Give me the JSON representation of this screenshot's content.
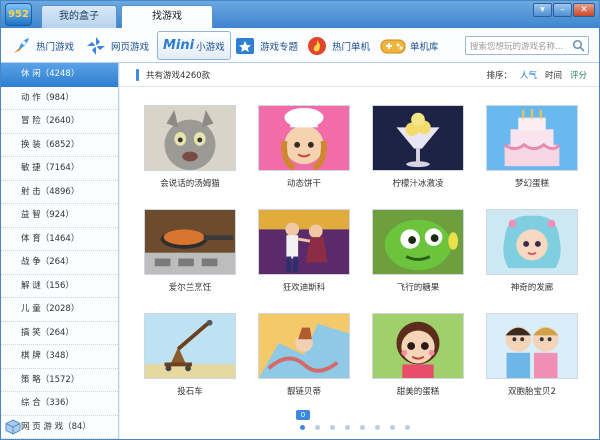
{
  "titlebar": {
    "logo_text": "952",
    "tabs": [
      {
        "label": "我的盒子"
      },
      {
        "label": "找游戏"
      }
    ]
  },
  "toolbar": {
    "items": [
      {
        "label": "热门游戏",
        "icon": "rocket-icon"
      },
      {
        "label": "网页游戏",
        "icon": "windmill-icon"
      },
      {
        "badge": "Mini",
        "label": "小游戏",
        "icon": "mini-icon"
      },
      {
        "label": "游戏专题",
        "icon": "star-icon"
      },
      {
        "label": "热门单机",
        "icon": "fire-icon"
      },
      {
        "label": "单机库",
        "icon": "gamepad-icon"
      }
    ],
    "search_placeholder": "搜索您想玩的游戏名称..."
  },
  "sidebar": {
    "items": [
      {
        "label": "休 闲（4248）"
      },
      {
        "label": "动 作（984）"
      },
      {
        "label": "冒 险（2640）"
      },
      {
        "label": "换 装（6852）"
      },
      {
        "label": "敏 捷（7164）"
      },
      {
        "label": "射 击（4896）"
      },
      {
        "label": "益 智（924）"
      },
      {
        "label": "体 育（1464）"
      },
      {
        "label": "战 争（264）"
      },
      {
        "label": "解 谜（156）"
      },
      {
        "label": "儿 童（2028）"
      },
      {
        "label": "搞 笑（264）"
      },
      {
        "label": "棋 牌（348）"
      },
      {
        "label": "策 略（1572）"
      },
      {
        "label": "综 合（336）"
      },
      {
        "label": "网 页 游 戏（84）"
      }
    ]
  },
  "main": {
    "total_text": "共有游戏4260款",
    "sort_label": "排序：",
    "sort_options": [
      {
        "label": "人气"
      },
      {
        "label": "时间"
      },
      {
        "label": "评分"
      }
    ],
    "games": [
      {
        "title": "会说话的汤姆猫"
      },
      {
        "title": "动态饼干"
      },
      {
        "title": "柠檬汁冰激凌"
      },
      {
        "title": "梦幻蛋糕"
      },
      {
        "title": "爱尔兰烹饪"
      },
      {
        "title": "狂欢迪斯科"
      },
      {
        "title": "飞行的糖果"
      },
      {
        "title": "神奇的发廊"
      },
      {
        "title": "投石车"
      },
      {
        "title": "靓链贝蒂"
      },
      {
        "title": "甜美的蛋糕"
      },
      {
        "title": "双胞胎宝贝2"
      }
    ],
    "page_number": "0"
  },
  "colors": {
    "accent": "#3b8ae0",
    "sidebar_active": "#2f7fd2",
    "title_bar": "#4f8fd2"
  }
}
